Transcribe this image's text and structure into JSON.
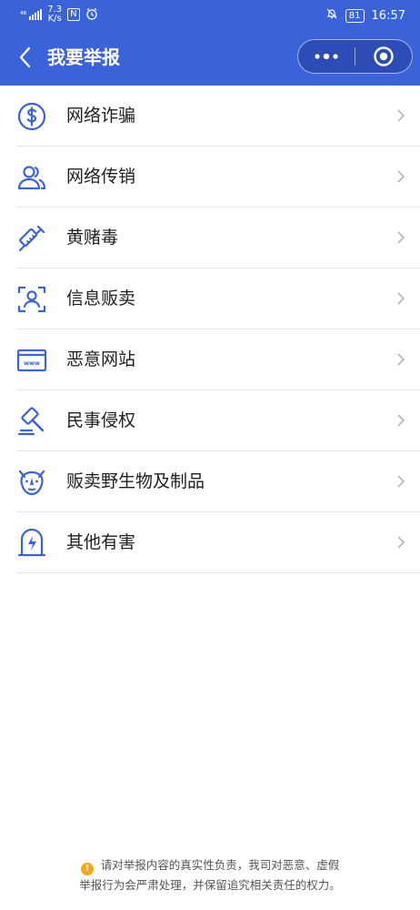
{
  "status_bar": {
    "signal": "⁴⁶",
    "net_speed_value": "7.3",
    "net_speed_unit": "K/s",
    "nfc": "N",
    "battery": "81",
    "time": "16:57"
  },
  "header": {
    "title": "我要举报",
    "colors": {
      "background": "#3b63d9",
      "accent_icon": "#3b63d9"
    }
  },
  "items": [
    {
      "label": "网络诈骗",
      "icon": "dollar-icon"
    },
    {
      "label": "网络传销",
      "icon": "users-icon"
    },
    {
      "label": "黄赌毒",
      "icon": "syringe-icon"
    },
    {
      "label": "信息贩卖",
      "icon": "user-scan-icon"
    },
    {
      "label": "恶意网站",
      "icon": "website-icon"
    },
    {
      "label": "民事侵权",
      "icon": "gavel-icon"
    },
    {
      "label": "贩卖野生物及制品",
      "icon": "rhino-icon"
    },
    {
      "label": "其他有害",
      "icon": "lightning-tombstone-icon"
    }
  ],
  "footer": {
    "line1": "请对举报内容的真实性负责，我司对恶意、虚假",
    "line2": "举报行为会严肃处理，并保留追究相关责任的权力。"
  }
}
